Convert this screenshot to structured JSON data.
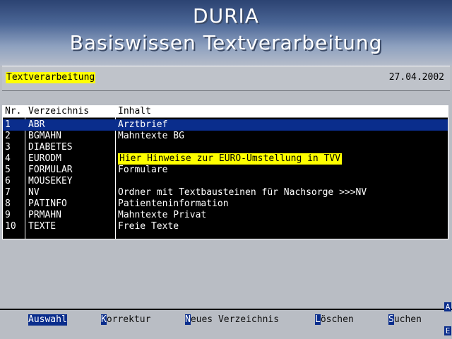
{
  "banner": {
    "title": "DURIA",
    "subtitle": "Basiswissen Textverarbeitung"
  },
  "infobar": {
    "section": "Textverarbeitung",
    "date": "27.04.2002"
  },
  "table": {
    "headers": [
      "Nr.",
      "Verzeichnis",
      "Inhalt"
    ],
    "rows": [
      {
        "nr": "1",
        "dir": "ABR",
        "content": "Arztbrief",
        "selected": true,
        "highlight": false
      },
      {
        "nr": "2",
        "dir": "BGMAHN",
        "content": "Mahntexte BG",
        "selected": false,
        "highlight": false
      },
      {
        "nr": "3",
        "dir": "DIABETES",
        "content": "",
        "selected": false,
        "highlight": false
      },
      {
        "nr": "4",
        "dir": "EURODM",
        "content": "Hier Hinweise zur EURO-Umstellung in TVV",
        "selected": false,
        "highlight": true
      },
      {
        "nr": "5",
        "dir": "FORMULAR",
        "content": "Formulare",
        "selected": false,
        "highlight": false
      },
      {
        "nr": "6",
        "dir": "MOUSEKEY",
        "content": "",
        "selected": false,
        "highlight": false
      },
      {
        "nr": "7",
        "dir": "NV",
        "content": "Ordner mit Textbausteinen für Nachsorge >>>NV",
        "selected": false,
        "highlight": false
      },
      {
        "nr": "8",
        "dir": "PATINFO",
        "content": "Patienteninformation",
        "selected": false,
        "highlight": false
      },
      {
        "nr": "9",
        "dir": "PRMAHN",
        "content": "Mahntexte Privat",
        "selected": false,
        "highlight": false
      },
      {
        "nr": "10",
        "dir": "TEXTE",
        "content": "Freie Texte",
        "selected": false,
        "highlight": false
      }
    ]
  },
  "functions": {
    "auswahl": {
      "label": "Auswahl"
    },
    "korrektur": {
      "key": "K",
      "rest": "orrektur"
    },
    "neu": {
      "key": "N",
      "rest": "eues Verzeichnis"
    },
    "loeschen": {
      "key": "L",
      "rest": "öschen"
    },
    "suchen": {
      "key": "S",
      "rest": "uchen"
    }
  },
  "corner": {
    "top": "A",
    "bottom": "E"
  },
  "colors": {
    "selection": "#0a2d8c",
    "highlight": "#ffff00",
    "background": "#b9bdc4"
  }
}
